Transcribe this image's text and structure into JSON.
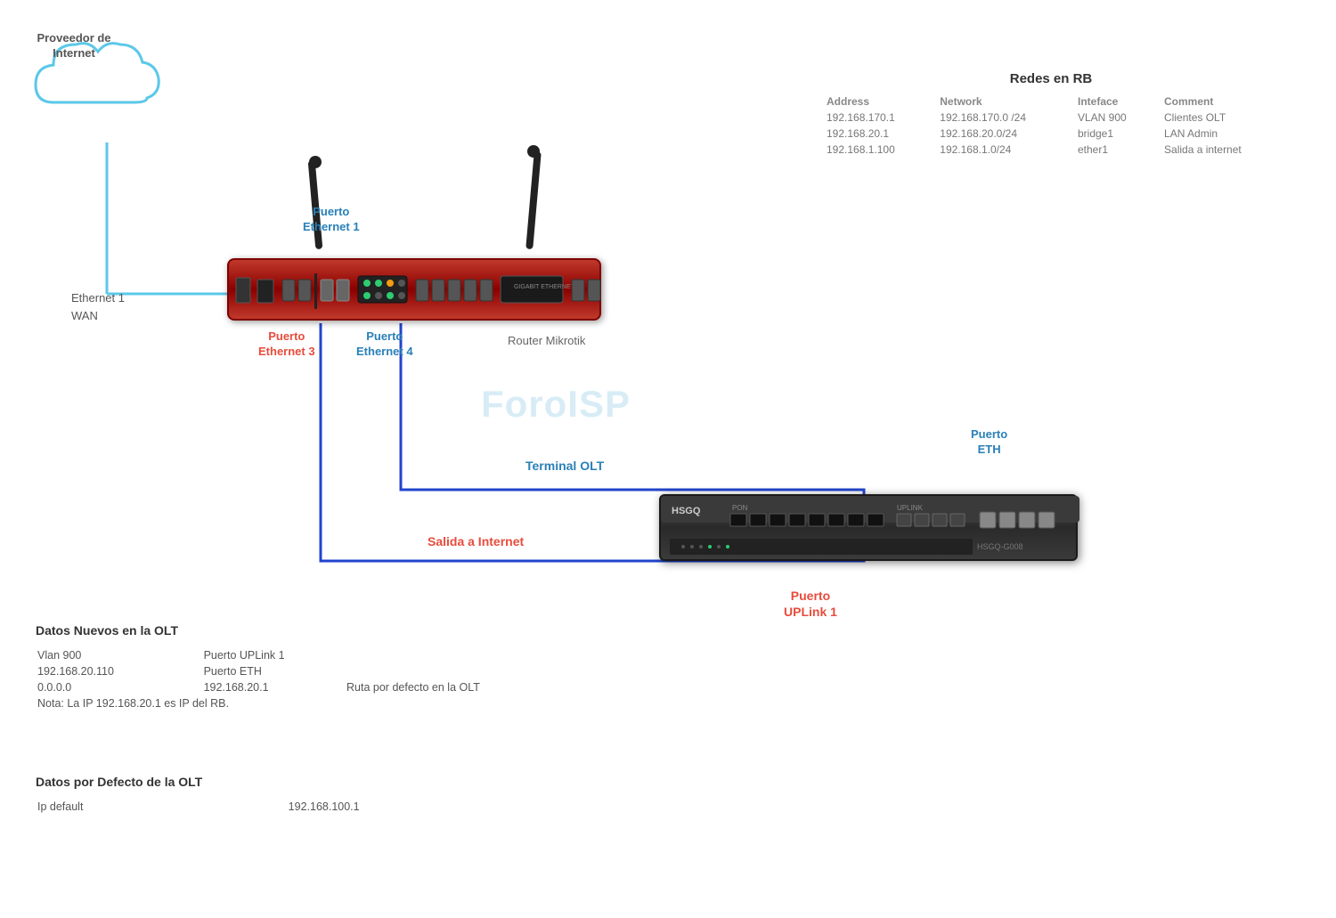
{
  "cloud": {
    "label_line1": "Proveedor de",
    "label_line2": "Internet"
  },
  "redes_rb": {
    "title": "Redes en RB",
    "headers": [
      "Address",
      "Network",
      "Inteface",
      "Comment"
    ],
    "rows": [
      [
        "192.168.170.1",
        "192.168.170.0 /24",
        "VLAN 900",
        "Clientes OLT"
      ],
      [
        "192.168.20.1",
        "192.168.20.0/24",
        "bridge1",
        "LAN Admin"
      ],
      [
        "192.168.1.100",
        "192.168.1.0/24",
        "ether1",
        "Salida a internet"
      ]
    ]
  },
  "router": {
    "label": "Router Mikrotik",
    "port_eth1_label_line1": "Puerto",
    "port_eth1_label_line2": "Ethernet 1",
    "port_eth3_label_line1": "Puerto",
    "port_eth3_label_line2": "Ethernet 3",
    "port_eth4_label_line1": "Puerto",
    "port_eth4_label_line2": "Ethernet 4",
    "eth1_wan_line1": "Ethernet 1",
    "eth1_wan_line2": "WAN"
  },
  "olt": {
    "brand": "HSGQ",
    "model": "HSGQ-G008",
    "port_eth_line1": "Puerto",
    "port_eth_line2": "ETH",
    "port_uplink_line1": "Puerto",
    "port_uplink_line2": "UPLink 1",
    "label_terminal": "Terminal OLT",
    "label_salida": "Salida a Internet"
  },
  "watermark": "ForoISP",
  "datos_nuevos": {
    "title": "Datos Nuevos en  la OLT",
    "rows": [
      [
        "Vlan 900",
        "Puerto UPLink 1",
        ""
      ],
      [
        "192.168.20.110",
        "Puerto ETH",
        ""
      ],
      [
        "0.0.0.0",
        "192.168.20.1",
        "Ruta  por defecto en la OLT"
      ]
    ],
    "nota": "Nota: La IP 192.168.20.1 es IP del RB."
  },
  "datos_defecto": {
    "title": "Datos por Defecto de la OLT",
    "rows": [
      [
        "Ip default",
        "192.168.100.1",
        ""
      ]
    ]
  }
}
